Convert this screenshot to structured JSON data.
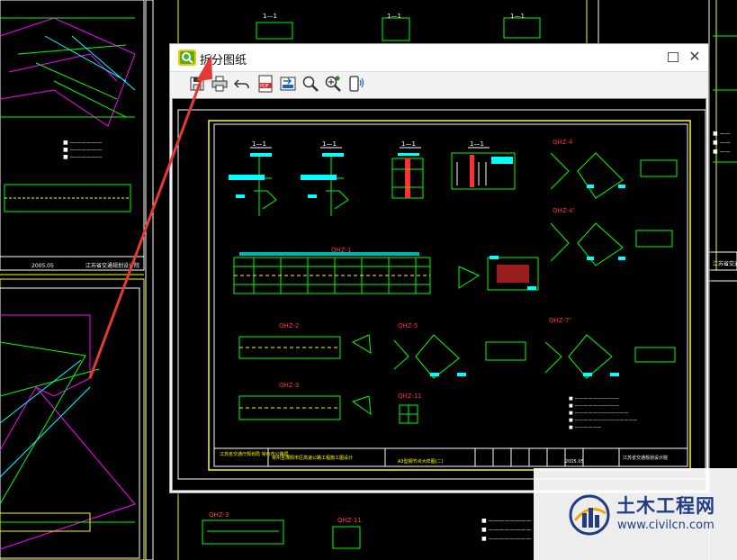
{
  "dialog": {
    "title": "拆分图纸",
    "maximize_icon": "maximize-icon",
    "close_icon": "close-icon",
    "toolbar": [
      {
        "name": "save-icon"
      },
      {
        "name": "print-icon"
      },
      {
        "name": "undo-icon"
      },
      {
        "name": "pdf-export-icon"
      },
      {
        "name": "image-export-icon"
      },
      {
        "name": "zoom-icon"
      },
      {
        "name": "zoom-extents-icon"
      },
      {
        "name": "send-to-phone-icon"
      }
    ]
  },
  "drawing": {
    "labels": [
      "1—1",
      "1—1",
      "1—1",
      "1—1",
      "QHZ-4",
      "QHZ-4'",
      "QHZ-1",
      "QHZ-2",
      "QHZ-5",
      "QHZ-7'",
      "QHZ-3",
      "QHZ-11"
    ],
    "title_block": {
      "company": "江苏省交通厅规划局\n常州市公路局",
      "project": "常州至溧阳市区高速公路工程施工图设计",
      "sheet": "A3型钢节点大样图(二)",
      "date": "2005.05",
      "designer": "江苏省交通规划设计院"
    }
  },
  "background": {
    "title_left": "江苏省交通规划设计院",
    "date_left": "2005.05",
    "title_right": "江苏省交通规划设计院",
    "bottom_labels": [
      "QHZ-3",
      "QHZ-11"
    ]
  },
  "watermark": {
    "name": "土木工程网",
    "url": "www.civilcn.com"
  }
}
